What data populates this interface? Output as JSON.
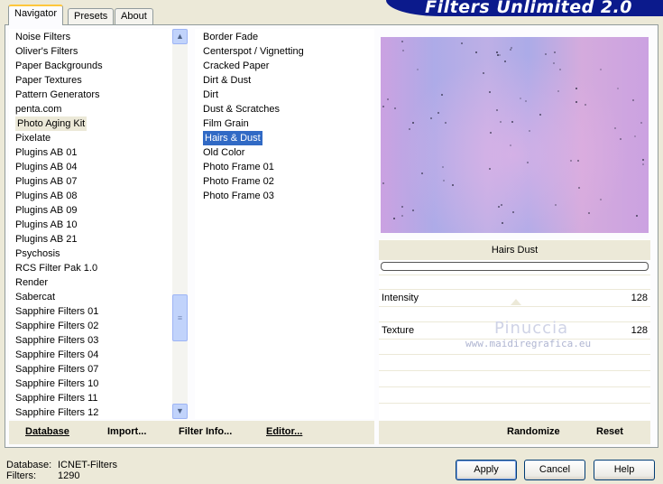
{
  "banner": {
    "title": "Filters Unlimited 2.0"
  },
  "tabs": [
    {
      "label": "Navigator"
    },
    {
      "label": "Presets"
    },
    {
      "label": "About"
    }
  ],
  "categories": {
    "items": [
      "Noise Filters",
      "Oliver's Filters",
      "Paper Backgrounds",
      "Paper Textures",
      "Pattern Generators",
      "penta.com",
      "Photo Aging Kit",
      "Pixelate",
      "Plugins AB 01",
      "Plugins AB 04",
      "Plugins AB 07",
      "Plugins AB 08",
      "Plugins AB 09",
      "Plugins AB 10",
      "Plugins AB 21",
      "Psychosis",
      "RCS Filter Pak 1.0",
      "Render",
      "Sabercat",
      "Sapphire Filters 01",
      "Sapphire Filters 02",
      "Sapphire Filters 03",
      "Sapphire Filters 04",
      "Sapphire Filters 07",
      "Sapphire Filters 10",
      "Sapphire Filters 11",
      "Sapphire Filters 12"
    ],
    "selected": "Photo Aging Kit"
  },
  "filters": {
    "items": [
      "Border Fade",
      "Centerspot / Vignetting",
      "Cracked Paper",
      "Dirt & Dust",
      "Dirt",
      "Dust & Scratches",
      "Film Grain",
      "Hairs & Dust",
      "Old Color",
      "Photo Frame 01",
      "Photo Frame 02",
      "Photo Frame 03"
    ],
    "selected": "Hairs & Dust"
  },
  "filter_settings": {
    "title": "Hairs  Dust",
    "sliders": [
      {
        "label": "Intensity",
        "value": "128"
      },
      {
        "label": "Texture",
        "value": "128"
      }
    ]
  },
  "watermark": {
    "line1": "Pinuccia",
    "line2": "www.maidiregrafica.eu"
  },
  "toolbar": {
    "database": "Database",
    "import": "Import...",
    "filter_info": "Filter Info...",
    "editor": "Editor...",
    "randomize": "Randomize",
    "reset": "Reset"
  },
  "footer": {
    "database_label": "Database:",
    "database_value": "ICNET-Filters",
    "filters_label": "Filters:",
    "filters_value": "1290"
  },
  "buttons": {
    "apply": "Apply",
    "cancel": "Cancel",
    "help": "Help"
  }
}
